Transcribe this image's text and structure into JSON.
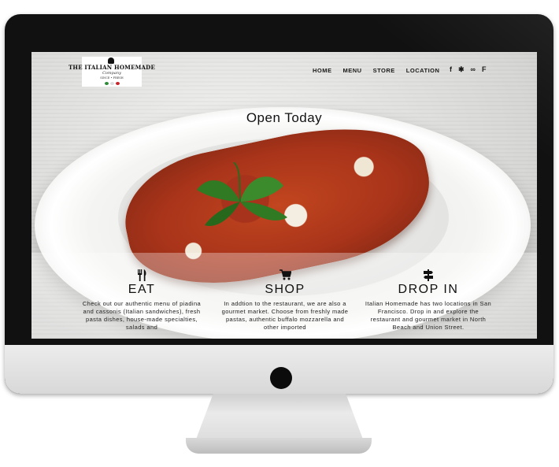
{
  "logo": {
    "title": "THE ITALIAN HOMEMADE",
    "subtitle": "Company",
    "tagline": "SINCE  •  FRESH",
    "dot_colors": [
      "#2e8b3a",
      "#ffffff",
      "#c8252b"
    ]
  },
  "nav": {
    "items": [
      "HOME",
      "MENU",
      "STORE",
      "LOCATION"
    ]
  },
  "social": {
    "icons": [
      "facebook-icon",
      "yelp-icon",
      "tripadvisor-icon",
      "foursquare-icon"
    ],
    "glyphs": [
      "f",
      "✱",
      "∞",
      "F"
    ]
  },
  "hero": {
    "headline": "Open Today"
  },
  "sections": [
    {
      "icon": "fork-knife-icon",
      "title": "EAT",
      "text": "Check out our authentic menu of piadina and cassonis (Italian sandwiches), fresh pasta dishes, house-made specialties, salads and"
    },
    {
      "icon": "shopping-cart-icon",
      "title": "SHOP",
      "text": "In addtion to the restaurant, we are also a gourmet market. Choose from freshly made pastas, authentic buffalo mozzarella and other imported"
    },
    {
      "icon": "signpost-icon",
      "title": "DROP IN",
      "text": "Italian Homemade has two locations in San Francisco. Drop in and explore the restaurant and gourmet market in North Beach and Union Street."
    }
  ]
}
